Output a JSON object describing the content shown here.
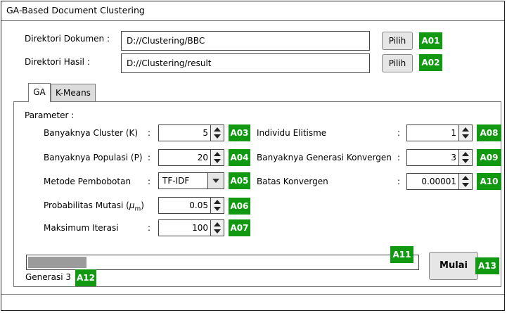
{
  "window": {
    "title": "GA-Based Document Clustering"
  },
  "paths": {
    "doc_dir_label": "Direktori Dokumen :",
    "doc_dir_value": "D://Clustering/BBC",
    "result_dir_label": "Direktori Hasil :",
    "result_dir_value": "D://Clustering/result",
    "browse_label": "Pilih",
    "badge_doc": "A01",
    "badge_result": "A02"
  },
  "tabs": [
    {
      "label": "GA",
      "active": true
    },
    {
      "label": "K-Means",
      "active": false
    }
  ],
  "params": {
    "header": "Parameter :",
    "colon": ":",
    "left": [
      {
        "label": "Banyaknya Cluster (K)",
        "value": "5",
        "badge": "A03"
      },
      {
        "label": "Banyaknya Populasi (P)",
        "value": "20",
        "badge": "A04"
      },
      {
        "label": "Metode Pembobotan",
        "value": "TF-IDF",
        "badge": "A05"
      },
      {
        "label_main": "Probabilitas Mutasi (",
        "label_mu": "μ",
        "label_sub": "m",
        "label_end": ")",
        "value": "0.05",
        "badge": "A06"
      },
      {
        "label": "Maksimum Iterasi",
        "value": "100",
        "badge": "A07"
      }
    ],
    "right": [
      {
        "label": "Individu Elitisme",
        "value": "1",
        "badge": "A08"
      },
      {
        "label": "Banyaknya Generasi Konvergen",
        "value": "3",
        "badge": "A09"
      },
      {
        "label": "Batas Konvergen",
        "value": "0.00001",
        "badge": "A10"
      }
    ]
  },
  "progress": {
    "fraction": 0.15,
    "badge": "A11"
  },
  "status": {
    "text": "Generasi 3",
    "badge": "A12"
  },
  "start": {
    "label": "Mulai",
    "badge": "A13"
  },
  "colors": {
    "badge_bg": "#119a11",
    "progress_fill": "#9b9b9b",
    "tab_inactive": "#dcdcdc"
  },
  "icons": [
    "spinner-up-icon",
    "spinner-down-icon",
    "dropdown-arrow-icon"
  ]
}
